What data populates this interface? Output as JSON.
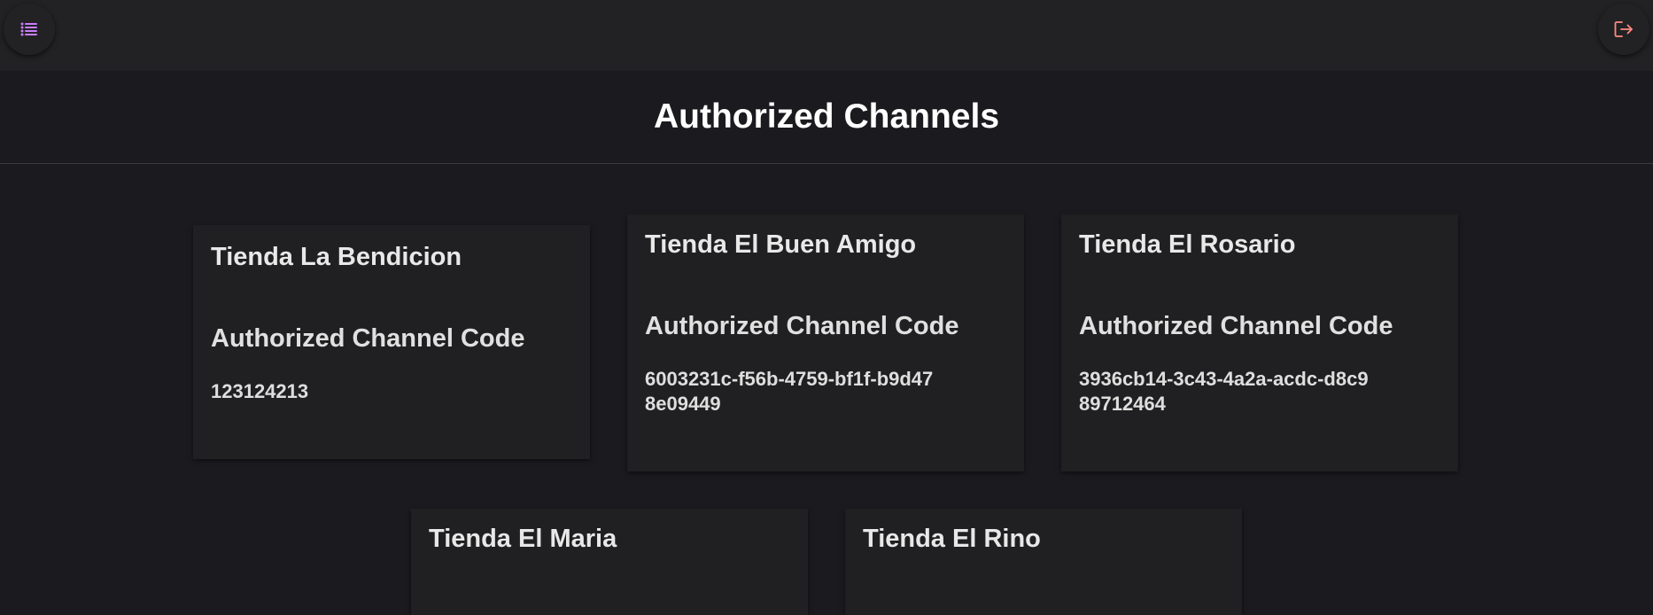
{
  "app": {
    "title": "Authorized Channels",
    "accent_color": "#c77dff",
    "logout_color": "#ff8a80"
  },
  "header": {
    "menu_icon": "list-icon",
    "logout_icon": "logout-icon"
  },
  "channels": [
    {
      "name": "Tienda La Bendicion",
      "code_label": "Authorized Channel Code",
      "code": "123124213"
    },
    {
      "name": "Tienda El Buen Amigo",
      "code_label": "Authorized Channel Code",
      "code": "6003231c-f56b-4759-bf1f-b9d478e09449"
    },
    {
      "name": "Tienda El Rosario",
      "code_label": "Authorized Channel Code",
      "code": "3936cb14-3c43-4a2a-acdc-d8c989712464"
    },
    {
      "name": "Tienda El Maria"
    },
    {
      "name": "Tienda El Rino"
    }
  ]
}
